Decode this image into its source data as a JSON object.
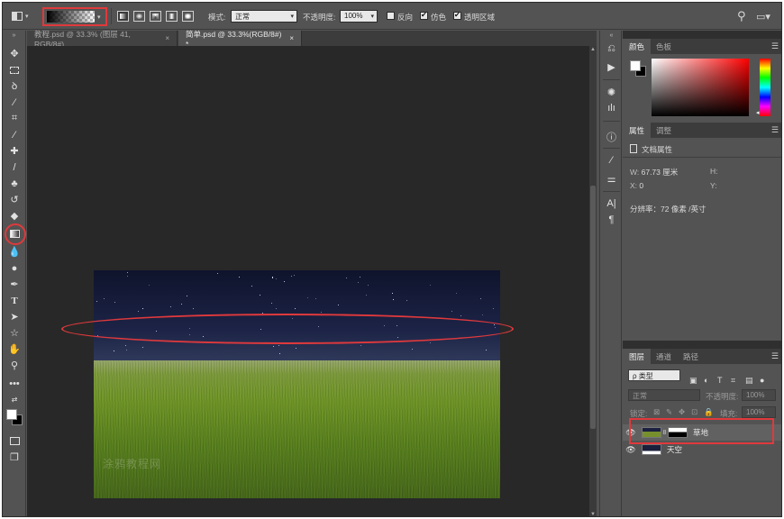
{
  "options_bar": {
    "mode_label": "模式:",
    "mode_value": "正常",
    "opacity_label": "不透明度:",
    "opacity_value": "100%",
    "reverse_label": "反向",
    "dither_label": "仿色",
    "transparency_label": "透明区域",
    "reverse_checked": false,
    "dither_checked": true,
    "transparency_checked": true
  },
  "doc_tabs": [
    {
      "label": "教程.psd @ 33.3% (图层 41, RGB/8#)",
      "close": "×",
      "active": false
    },
    {
      "label": "简单.psd @ 33.3%(RGB/8#) *",
      "close": "×",
      "active": true
    }
  ],
  "canvas": {
    "watermark": "涂鸦教程网"
  },
  "panels": {
    "color": {
      "tabs": [
        "颜色",
        "色板"
      ],
      "hue_marker": "◂"
    },
    "properties": {
      "tabs": [
        "属性",
        "调整"
      ],
      "title": "文档属性",
      "w_label": "W:",
      "w_value": "67.73 厘米",
      "h_label": "H:",
      "h_value": "",
      "x_label": "X:",
      "x_value": "0",
      "y_label": "Y:",
      "y_value": "",
      "resolution": "分辨率：72 像素 /英寸"
    },
    "layers": {
      "tabs": [
        "图层",
        "通道",
        "路径"
      ],
      "filter_label": "ρ 类型",
      "blend_mode": "正常",
      "opacity_label": "不透明度:",
      "opacity_value": "100%",
      "lock_label": "锁定:",
      "fill_label": "填充:",
      "fill_value": "100%",
      "items": [
        {
          "name": "草地",
          "selected": true,
          "has_mask": true
        },
        {
          "name": "天空",
          "selected": false,
          "has_mask": false
        }
      ]
    }
  },
  "colors": {
    "ui_bg": "#535353",
    "canvas_bg": "#282828",
    "highlight_red": "#e0393c"
  }
}
